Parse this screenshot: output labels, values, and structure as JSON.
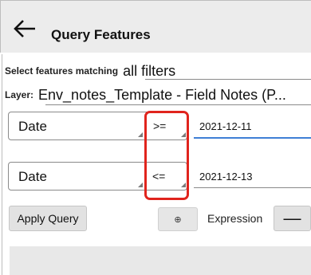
{
  "header": {
    "title": "Query Features"
  },
  "match": {
    "label": "Select features matching",
    "value": "all filters"
  },
  "layer": {
    "label": "Layer:",
    "value": "Env_notes_Template - Field Notes (P..."
  },
  "filters": [
    {
      "field": "Date",
      "operator": ">=",
      "value": "2021-12-11"
    },
    {
      "field": "Date",
      "operator": "<=",
      "value": "2021-12-13"
    }
  ],
  "buttons": {
    "apply": "Apply Query",
    "add_symbol": "⊕",
    "expression": "Expression",
    "remove": "—"
  },
  "colors": {
    "highlight": "#e0241d",
    "active_underline": "#3f7fd6",
    "header_bg": "#ececec"
  }
}
